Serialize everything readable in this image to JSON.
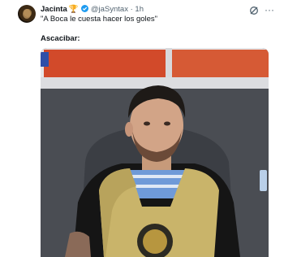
{
  "tweet": {
    "author_name": "Jacinta",
    "author_emoji": "🏆",
    "handle": "@jaSyntax",
    "separator": "·",
    "time": "1h",
    "text": "\"A Boca le cuesta hacer los goles\"",
    "caption": "Ascacibar:",
    "verified_color": "#1d9bf0"
  },
  "icons": {
    "grok": "grok-icon",
    "more": "more-icon",
    "verified": "verified-badge-icon"
  },
  "more_glyph": "···"
}
